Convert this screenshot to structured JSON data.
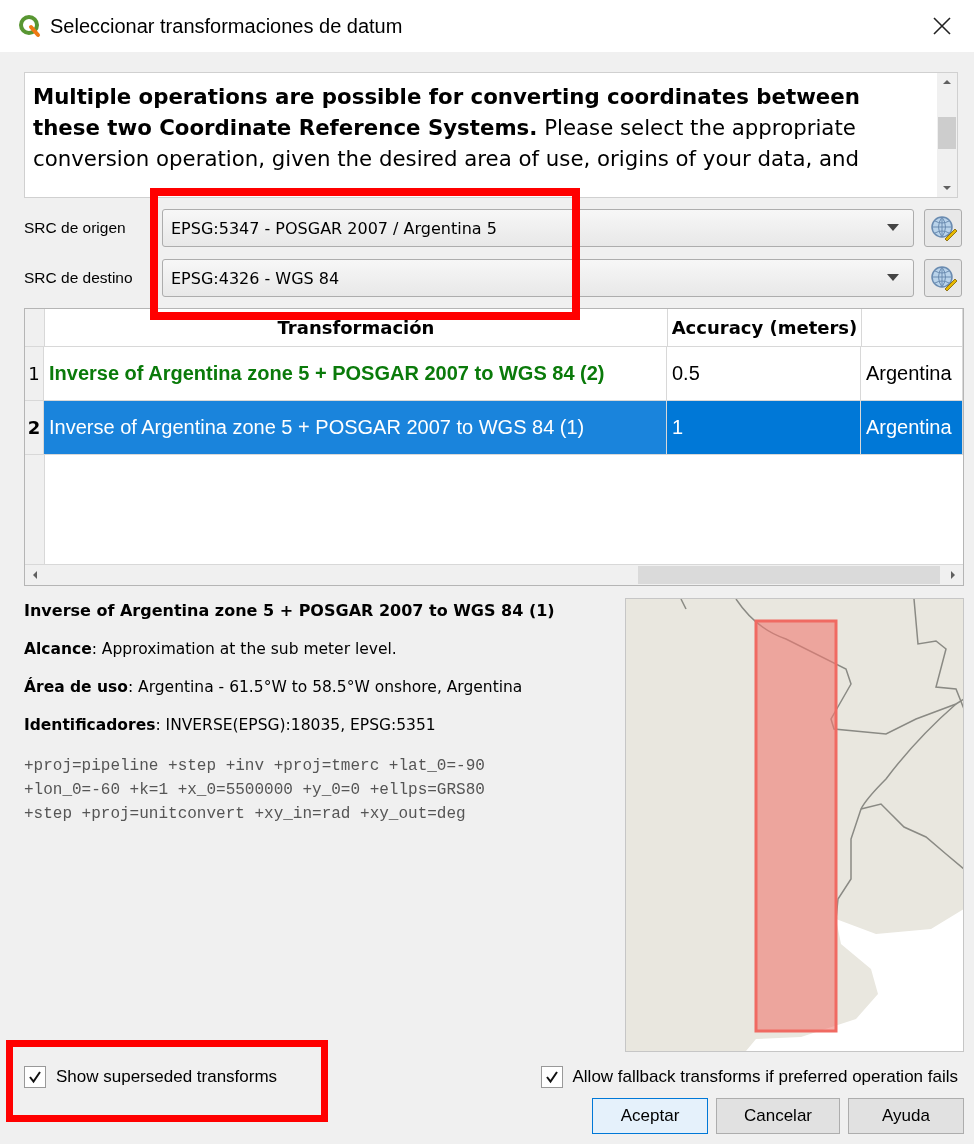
{
  "window": {
    "title": "Seleccionar transformaciones de datum"
  },
  "message": "**Multiple operations are possible for converting coordinates between these two Coordinate Reference Systems.** Please select the appropriate conversion operation, given the desired area of use, origins of your data, and",
  "source_crs": {
    "label": "SRC de origen",
    "value": "EPSG:5347 - POSGAR 2007 / Argentina 5"
  },
  "target_crs": {
    "label": "SRC de destino",
    "value": "EPSG:4326 - WGS 84"
  },
  "table": {
    "columns": [
      "Transformación",
      "Accuracy (meters)"
    ],
    "rows": [
      {
        "number": "1",
        "transformation": "Inverse of Argentina zone 5 + POSGAR 2007 to WGS 84 (2)",
        "accuracy": "0.5",
        "column_3": "Argentina",
        "preferred": true,
        "selected": false
      },
      {
        "number": "2",
        "transformation": "Inverse of Argentina zone 5 + POSGAR 2007 to WGS 84 (1)",
        "accuracy": "1",
        "column_3": "Argentina",
        "preferred": false,
        "selected": true
      }
    ]
  },
  "details": {
    "title": "Inverse of Argentina zone 5 + POSGAR 2007 to WGS 84 (1)",
    "fields": [
      "**Alcance**: Approximation at the sub meter level.",
      "**Área de uso**: Argentina - 61.5°W to 58.5°W onshore, Argentina",
      "**Identificadores**: INVERSE(EPSG):18035, EPSG:5351"
    ],
    "proj_lines": [
      "+proj=pipeline +step +inv +proj=tmerc +lat_0=-90",
      "+lon_0=-60 +k=1 +x_0=5500000 +y_0=0 +ellps=GRS80",
      "+step +proj=unitconvert +xy_in=rad +xy_out=deg"
    ]
  },
  "checkboxes": [
    {
      "label": "Show superseded transforms",
      "checked": true
    },
    {
      "label": "Allow fallback transforms if preferred operation fails",
      "checked": true
    }
  ],
  "buttons": [
    {
      "label": "Aceptar",
      "default": true
    },
    {
      "label": "Cancelar",
      "default": false
    },
    {
      "label": "Ayuda",
      "default": false
    }
  ]
}
